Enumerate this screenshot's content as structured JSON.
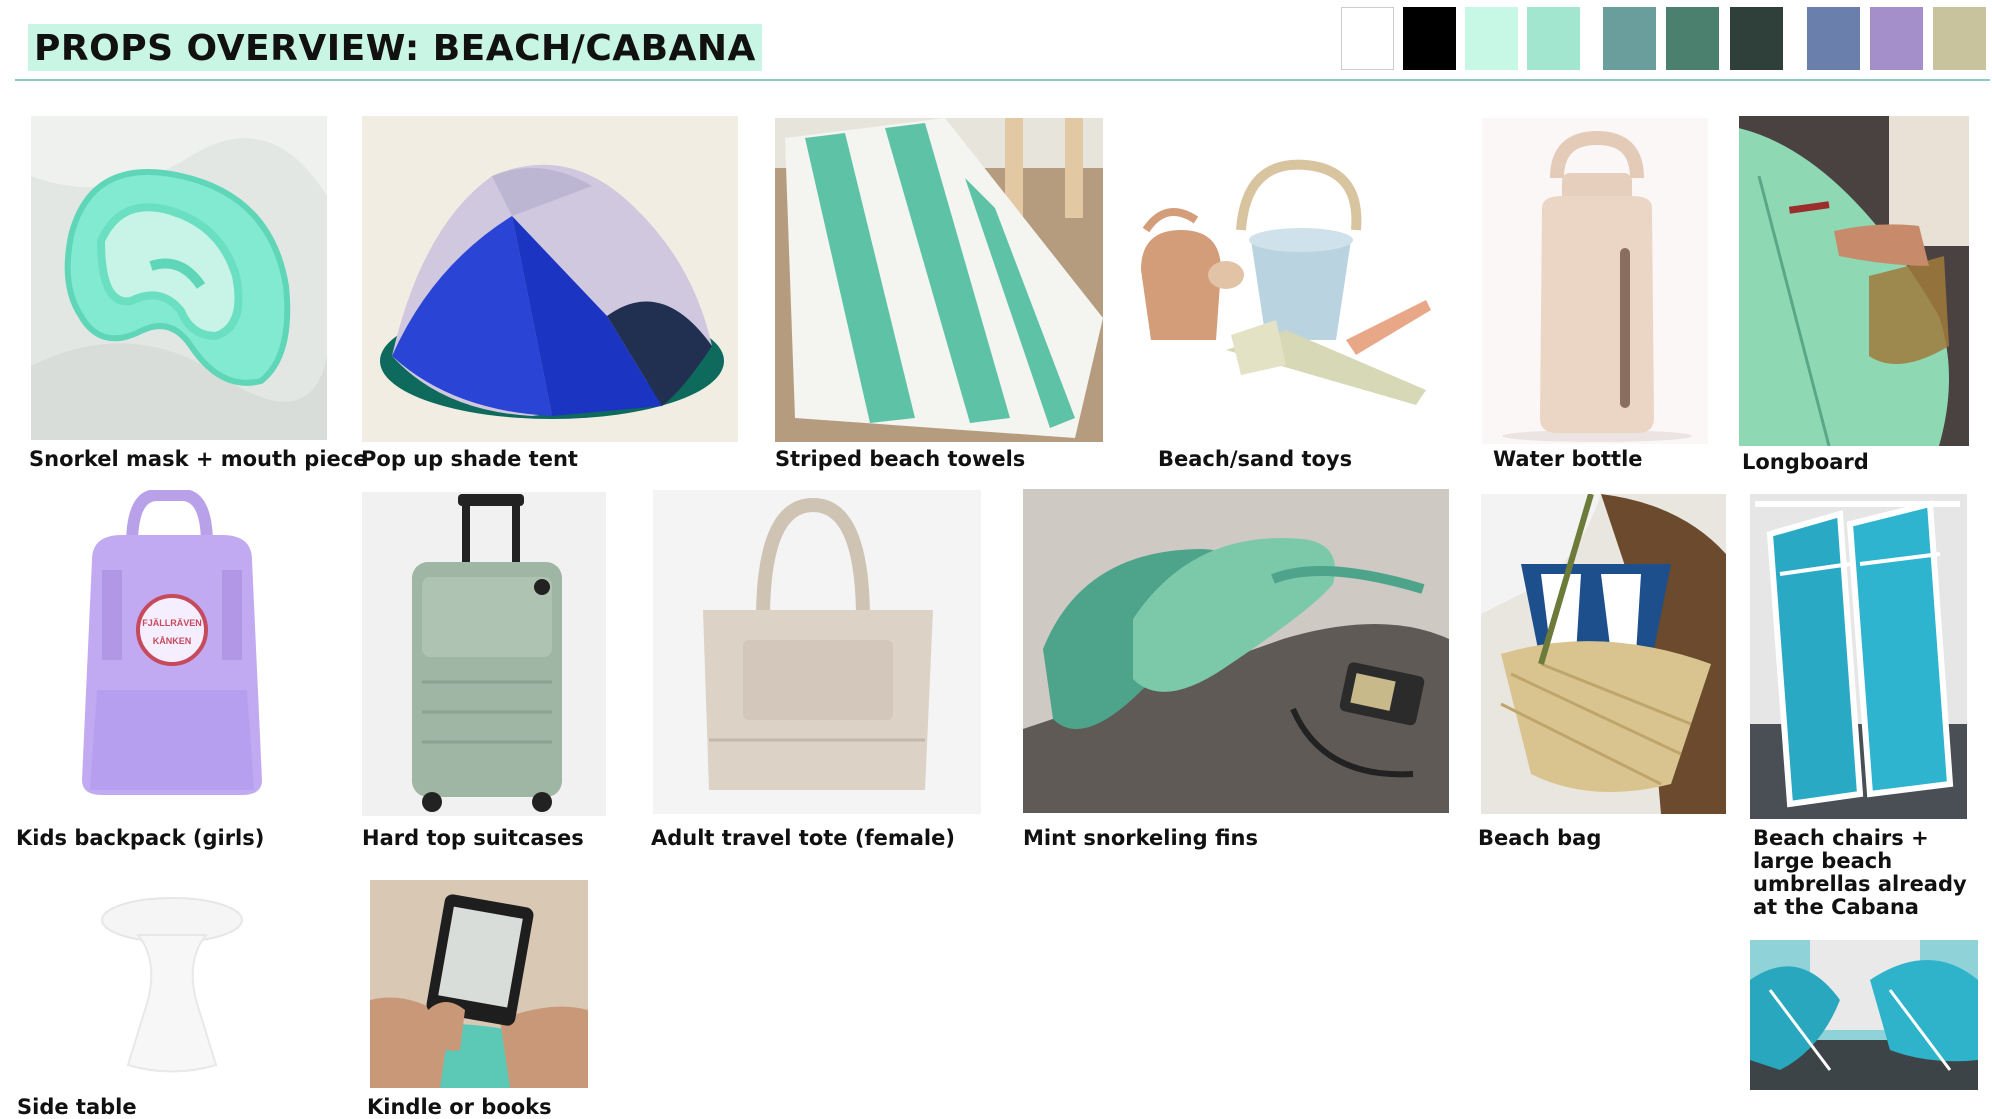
{
  "header": {
    "title": "PROPS OVERVIEW: BEACH/CABANA"
  },
  "palette": [
    "#ffffff",
    "#000000",
    "#c7f8e6",
    "#a2e6cf",
    "#6a9e9d",
    "#4b7f6e",
    "#2f403a",
    "#6b7fad",
    "#a48fcb",
    "#c9c39d"
  ],
  "props": [
    {
      "label": "Snorkel mask + mouth piece",
      "icon": "snorkel-mask-icon"
    },
    {
      "label": "Pop up shade tent",
      "icon": "tent-icon"
    },
    {
      "label": "Striped beach towels",
      "icon": "towel-icon"
    },
    {
      "label": "Beach/sand toys",
      "icon": "sand-toys-icon"
    },
    {
      "label": "Water bottle",
      "icon": "water-bottle-icon"
    },
    {
      "label": "Longboard",
      "icon": "surfboard-icon"
    },
    {
      "label": "Kids backpack (girls)",
      "icon": "backpack-icon"
    },
    {
      "label": "Hard top suitcases",
      "icon": "suitcase-icon"
    },
    {
      "label": "Adult travel tote (female)",
      "icon": "tote-bag-icon"
    },
    {
      "label": "Mint snorkeling fins",
      "icon": "fins-icon"
    },
    {
      "label": "Beach bag",
      "icon": "beach-bag-icon"
    },
    {
      "label": "Beach chairs +\nlarge beach\numbrellas already\nat the Cabana",
      "icon": "beach-chairs-icon"
    },
    {
      "label": "Side table",
      "icon": "side-table-icon"
    },
    {
      "label": "Kindle or books",
      "icon": "ereader-icon"
    }
  ],
  "extra_photos": [
    {
      "icon": "beach-umbrellas-icon"
    }
  ],
  "backpack_logo_text": "FJÄLLRÄVEN KÅNKEN"
}
